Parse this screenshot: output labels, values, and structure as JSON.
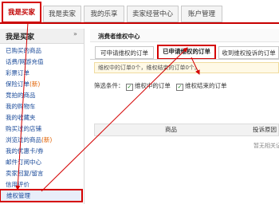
{
  "topnav": {
    "tabs": [
      {
        "label": "我是买家"
      },
      {
        "label": "我是卖家"
      },
      {
        "label": "我的乐享"
      },
      {
        "label": "卖家经营中心"
      },
      {
        "label": "账户管理"
      }
    ]
  },
  "sidebar": {
    "title": "我是买家",
    "items": [
      {
        "label": "已购买的商品"
      },
      {
        "label": "话费/网游充值"
      },
      {
        "label": "彩票订单"
      },
      {
        "label": "保险订单",
        "badge": "(新)"
      },
      {
        "label": "竞拍的商品"
      },
      {
        "label": "我的购物车"
      },
      {
        "label": "我的收藏夹"
      },
      {
        "label": "购买过的店铺"
      },
      {
        "label": "浏览过的商品",
        "badge": "(新)"
      },
      {
        "label": "我的优惠卡/券"
      },
      {
        "label": "邮件订阅中心"
      },
      {
        "label": "卖家回复/留言"
      },
      {
        "label": "信用评价"
      },
      {
        "label": "维权管理"
      }
    ]
  },
  "main": {
    "title": "消费者维权中心",
    "subtabs": [
      {
        "label": "可申请维权的订单"
      },
      {
        "label": "已申请维权的订单"
      },
      {
        "label": "收到维权投诉的订单"
      }
    ],
    "summary": "维权中的订单0个，维权结束的订单0个。",
    "filter": {
      "label": "筛选条件：",
      "options": [
        {
          "label": "维权中的订单"
        },
        {
          "label": "维权结束的订单"
        }
      ]
    },
    "table": {
      "headers": [
        "商品",
        "投诉原因"
      ],
      "empty_text": "暂无相关记录"
    }
  },
  "colors": {
    "accent": "#d40000",
    "link": "#1a4a99"
  }
}
